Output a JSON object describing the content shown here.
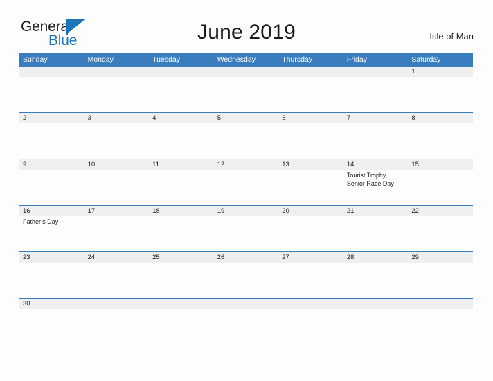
{
  "brand": {
    "name_part1": "General",
    "name_part2": "Blue",
    "flag_icon": "blue-flag-triangle",
    "color_dark": "#231f20",
    "color_blue": "#1b75bb"
  },
  "header": {
    "title": "June 2019",
    "region": "Isle of Man"
  },
  "colors": {
    "header_blue": "#3a7dbe",
    "row_line_blue": "#3a7dbe",
    "daynum_band_gray": "#efefef",
    "page_background": "#fdfdfd",
    "text_dark": "#222222",
    "header_text": "#ffffff"
  },
  "calendar": {
    "weekdays": [
      "Sunday",
      "Monday",
      "Tuesday",
      "Wednesday",
      "Thursday",
      "Friday",
      "Saturday"
    ],
    "weeks": [
      {
        "days": [
          {
            "num": "",
            "events": []
          },
          {
            "num": "",
            "events": []
          },
          {
            "num": "",
            "events": []
          },
          {
            "num": "",
            "events": []
          },
          {
            "num": "",
            "events": []
          },
          {
            "num": "",
            "events": []
          },
          {
            "num": "1",
            "events": []
          }
        ]
      },
      {
        "days": [
          {
            "num": "2",
            "events": []
          },
          {
            "num": "3",
            "events": []
          },
          {
            "num": "4",
            "events": []
          },
          {
            "num": "5",
            "events": []
          },
          {
            "num": "6",
            "events": []
          },
          {
            "num": "7",
            "events": []
          },
          {
            "num": "8",
            "events": []
          }
        ]
      },
      {
        "days": [
          {
            "num": "9",
            "events": []
          },
          {
            "num": "10",
            "events": []
          },
          {
            "num": "11",
            "events": []
          },
          {
            "num": "12",
            "events": []
          },
          {
            "num": "13",
            "events": []
          },
          {
            "num": "14",
            "events": [
              "Tourist Trophy,",
              "Senior Race Day"
            ]
          },
          {
            "num": "15",
            "events": []
          }
        ]
      },
      {
        "days": [
          {
            "num": "16",
            "events": [
              "Father’s Day"
            ]
          },
          {
            "num": "17",
            "events": []
          },
          {
            "num": "18",
            "events": []
          },
          {
            "num": "19",
            "events": []
          },
          {
            "num": "20",
            "events": []
          },
          {
            "num": "21",
            "events": []
          },
          {
            "num": "22",
            "events": []
          }
        ]
      },
      {
        "days": [
          {
            "num": "23",
            "events": []
          },
          {
            "num": "24",
            "events": []
          },
          {
            "num": "25",
            "events": []
          },
          {
            "num": "26",
            "events": []
          },
          {
            "num": "27",
            "events": []
          },
          {
            "num": "28",
            "events": []
          },
          {
            "num": "29",
            "events": []
          }
        ]
      },
      {
        "days": [
          {
            "num": "30",
            "events": []
          },
          {
            "num": "",
            "events": []
          },
          {
            "num": "",
            "events": []
          },
          {
            "num": "",
            "events": []
          },
          {
            "num": "",
            "events": []
          },
          {
            "num": "",
            "events": []
          },
          {
            "num": "",
            "events": []
          }
        ]
      }
    ]
  }
}
